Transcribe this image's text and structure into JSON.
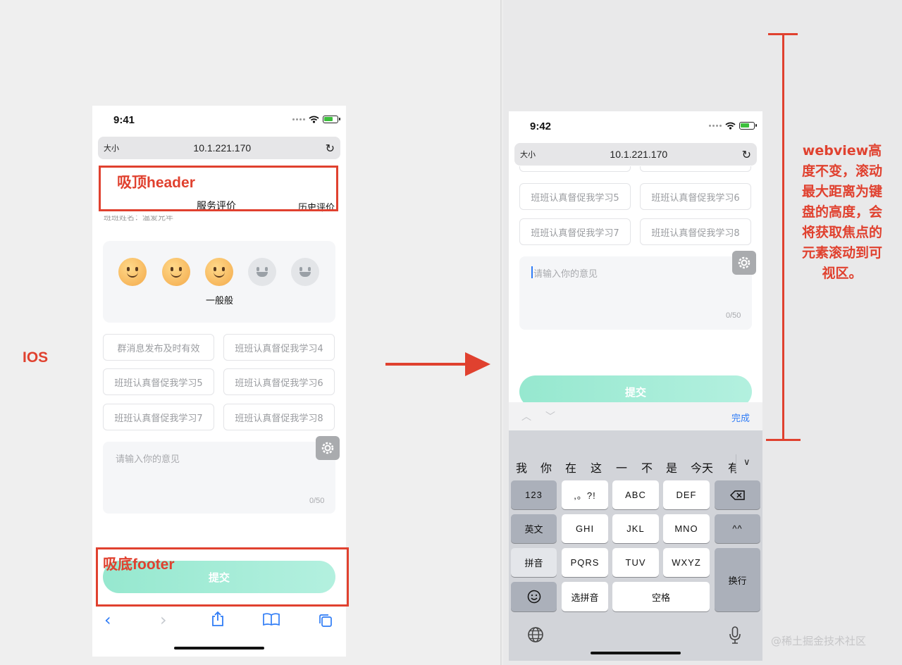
{
  "colors": {
    "annotation_red": "#e0412f",
    "ios_blue": "#2f7cf6",
    "submit_gradient": [
      "#96e8cf",
      "#b3f0df"
    ]
  },
  "annotations": {
    "header_label": "吸顶header",
    "footer_label": "吸底footer",
    "ios_label": "IOS",
    "side_note": "webview高度不变，滚动最大距离为键盘的高度，会将获取焦点的元素滚动到可视区。",
    "watermark": "@稀土掘金技术社区"
  },
  "phone_before": {
    "status_time": "9:41",
    "url": "10.1.221.170",
    "text_size_btn": "大小",
    "tabs": [
      "服务评价",
      "历史评价"
    ],
    "cut_text": "班班姓名：温爱兄年",
    "rating": {
      "icons": [
        "smile-face-icon",
        "smile-face-icon",
        "smile-face-icon",
        "neutral-face-icon",
        "neutral-face-icon"
      ],
      "selected_count": 3,
      "label": "一般般"
    },
    "chips": [
      "群消息发布及时有效",
      "班班认真督促我学习4",
      "班班认真督促我学习5",
      "班班认真督促我学习6",
      "班班认真督促我学习7",
      "班班认真督促我学习8"
    ],
    "textarea_placeholder": "请输入你的意见",
    "textarea_count": "0/50",
    "submit_label": "提交",
    "nav_icons": [
      "back-icon",
      "forward-icon",
      "share-icon",
      "bookmarks-icon",
      "tabs-icon"
    ]
  },
  "phone_after": {
    "status_time": "9:42",
    "url": "10.1.221.170",
    "text_size_btn": "大小",
    "chips": [
      "班班认真督促我学习5",
      "班班认真督促我学习6",
      "班班认真督促我学习7",
      "班班认真督促我学习8"
    ],
    "textarea_placeholder": "请输入你的意见",
    "textarea_count": "0/50",
    "submit_label": "提交",
    "done_label": "完成",
    "candidates": [
      "我",
      "你",
      "在",
      "这",
      "一",
      "不",
      "是",
      "今天",
      "有"
    ],
    "keys": {
      "row1": [
        "123",
        ",。?!",
        "ABC",
        "DEF"
      ],
      "row2": [
        "英文",
        "GHI",
        "JKL",
        "MNO",
        "^^"
      ],
      "row3": [
        "拼音",
        "PQRS",
        "TUV",
        "WXYZ"
      ],
      "row4": [
        "选拼音",
        "空格"
      ],
      "return": "换行"
    }
  }
}
